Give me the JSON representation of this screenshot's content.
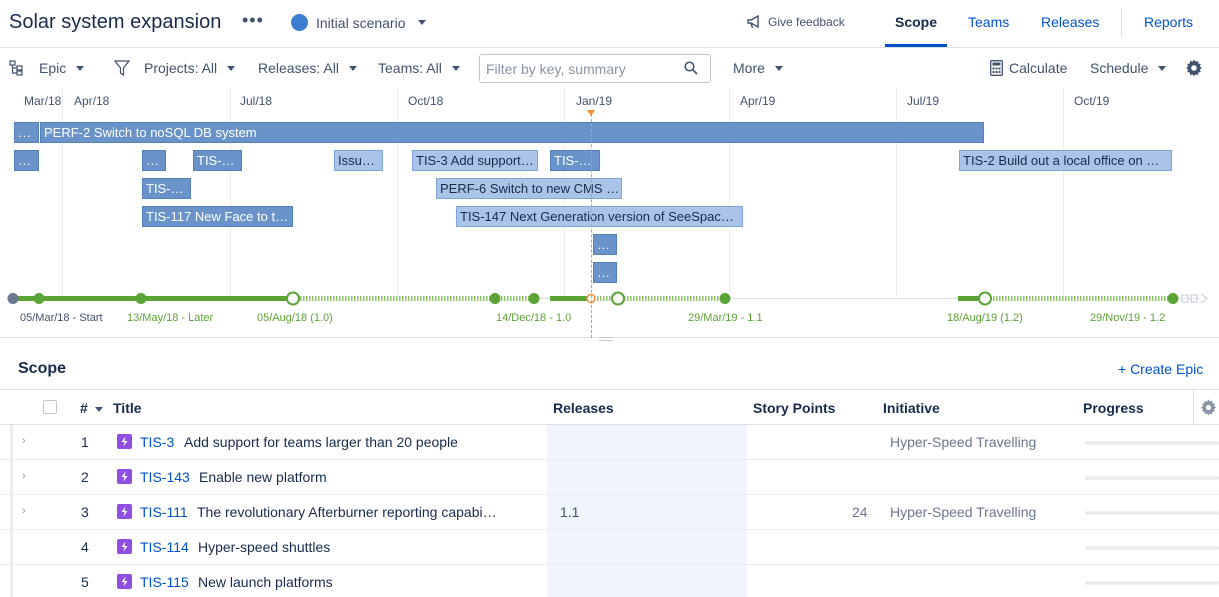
{
  "header": {
    "title": "Solar system expansion",
    "more": "•••",
    "scenario": "Initial scenario",
    "feedback": "Give feedback",
    "tabs": [
      "Scope",
      "Teams",
      "Releases",
      "Reports"
    ]
  },
  "toolbar": {
    "group_by": "Epic",
    "projects": "Projects: All",
    "releases": "Releases: All",
    "teams": "Teams: All",
    "filter_placeholder": "Filter by key, summary",
    "more": "More",
    "calculate": "Calculate",
    "schedule": "Schedule"
  },
  "timeline": {
    "months": [
      "Mar/18",
      "Apr/18",
      "Jul/18",
      "Oct/18",
      "Jan/19",
      "Apr/19",
      "Jul/19",
      "Oct/19"
    ],
    "bars": [
      "…",
      "PERF-2 Switch to noSQL DB system",
      "…",
      "…",
      "TIS-…",
      "Issu…",
      "TIS-3 Add support…",
      "TIS-…",
      "TIS-2 Build out a local office on …",
      "TIS-…",
      "PERF-6 Switch to new CMS …",
      "TIS-117 New Face to t…",
      "TIS-147 Next Generation version of SeeSpac…",
      "…",
      "…"
    ],
    "releases": [
      "05/Mar/18 - Start",
      "13/May/18 - Later",
      "05/Aug/18 (1.0)",
      "14/Dec/18 - 1.0",
      "29/Mar/19 - 1.1",
      "18/Aug/19 (1.2)",
      "29/Nov/19 - 1.2"
    ]
  },
  "scope": {
    "title": "Scope",
    "create": "+ Create Epic",
    "columns": {
      "num": "#",
      "title": "Title",
      "releases": "Releases",
      "story_points": "Story Points",
      "initiative": "Initiative",
      "progress": "Progress"
    },
    "rows": [
      {
        "num": "1",
        "key": "TIS-3",
        "summary": "Add support for teams larger than 20 people",
        "release": "",
        "points": "",
        "initiative": "Hyper-Speed Travelling"
      },
      {
        "num": "2",
        "key": "TIS-143",
        "summary": "Enable new platform",
        "release": "",
        "points": "",
        "initiative": ""
      },
      {
        "num": "3",
        "key": "TIS-111",
        "summary": "The revolutionary Afterburner reporting capabi…",
        "release": "1.1",
        "points": "24",
        "initiative": "Hyper-Speed Travelling"
      },
      {
        "num": "4",
        "key": "TIS-114",
        "summary": "Hyper-speed shuttles",
        "release": "",
        "points": "",
        "initiative": ""
      },
      {
        "num": "5",
        "key": "TIS-115",
        "summary": "New launch platforms",
        "release": "",
        "points": "",
        "initiative": ""
      }
    ]
  },
  "colors": {
    "accent": "#0052cc",
    "bar": "#6a94c9",
    "release_line": "#5ca335",
    "today": "#f79232",
    "epic": "#904ee2"
  }
}
